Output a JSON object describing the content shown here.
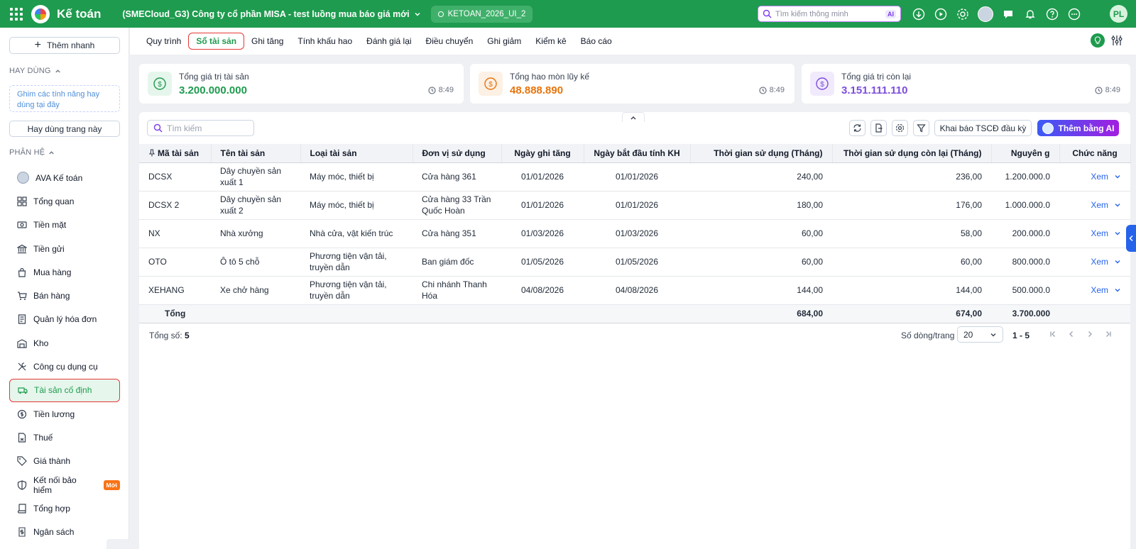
{
  "topbar": {
    "app_name": "Kế toán",
    "company": "(SMECloud_G3) Công ty cổ phần MISA - test luồng mua báo giá mới",
    "database": "KETOAN_2026_UI_2",
    "search_placeholder": "Tìm kiếm thông minh",
    "search_ai_badge": "AI",
    "user_initials": "PL"
  },
  "sidebar": {
    "quick_add": "Thêm nhanh",
    "section_frequent": "HAY DÙNG",
    "pin_hint": "Ghim các tính năng hay dùng tại đây",
    "use_this_page": "Hay dùng trang này",
    "section_modules": "PHÂN HỆ",
    "items": [
      {
        "label": "AVA Kế toán",
        "icon": "ava-avatar-icon"
      },
      {
        "label": "Tổng quan",
        "icon": "dashboard-icon"
      },
      {
        "label": "Tiền mặt",
        "icon": "cash-icon"
      },
      {
        "label": "Tiền gửi",
        "icon": "bank-icon"
      },
      {
        "label": "Mua hàng",
        "icon": "shopping-bag-icon"
      },
      {
        "label": "Bán hàng",
        "icon": "cart-icon"
      },
      {
        "label": "Quản lý hóa đơn",
        "icon": "invoice-icon"
      },
      {
        "label": "Kho",
        "icon": "warehouse-icon"
      },
      {
        "label": "Công cụ dụng cụ",
        "icon": "tools-icon"
      },
      {
        "label": "Tài sản cố định",
        "icon": "truck-icon"
      },
      {
        "label": "Tiền lương",
        "icon": "salary-icon"
      },
      {
        "label": "Thuế",
        "icon": "tax-document-icon"
      },
      {
        "label": "Giá thành",
        "icon": "price-tag-icon"
      },
      {
        "label": "Kết nối bảo hiểm",
        "icon": "shield-icon",
        "badge": "Mới"
      },
      {
        "label": "Tổng hợp",
        "icon": "summary-book-icon"
      },
      {
        "label": "Ngân sách",
        "icon": "budget-icon"
      }
    ]
  },
  "tabs": [
    "Quy trình",
    "Sổ tài sản",
    "Ghi tăng",
    "Tính khấu hao",
    "Đánh giá lại",
    "Điều chuyển",
    "Ghi giảm",
    "Kiểm kê",
    "Báo cáo"
  ],
  "active_tab": "Sổ tài sản",
  "cards": [
    {
      "label": "Tổng giá trị tài sản",
      "value": "3.200.000.000",
      "time": "8:49",
      "color": "#1e9b4e"
    },
    {
      "label": "Tổng hao mòn lũy kế",
      "value": "48.888.890",
      "time": "8:49",
      "color": "#e8740c"
    },
    {
      "label": "Tổng giá trị còn lại",
      "value": "3.151.111.110",
      "time": "8:49",
      "color": "#7c4ddb"
    }
  ],
  "toolbar": {
    "search_placeholder": "Tìm kiếm",
    "declare_button": "Khai báo TSCĐ đầu kỳ",
    "ai_button": "Thêm bằng AI"
  },
  "table": {
    "headers": [
      "Mã tài sản",
      "Tên tài sản",
      "Loại tài sản",
      "Đơn vị sử dụng",
      "Ngày ghi tăng",
      "Ngày bắt đầu tính KH",
      "Thời gian sử dụng (Tháng)",
      "Thời gian sử dụng còn lại (Tháng)",
      "Nguyên g",
      "Chức năng"
    ],
    "rows": [
      {
        "code": "DCSX",
        "name": "Dây chuyền sản xuất 1",
        "type": "Máy móc, thiết bị",
        "unit": "Cửa hàng 361",
        "date_added": "01/01/2026",
        "date_start": "01/01/2026",
        "life": "240,00",
        "remaining": "236,00",
        "cost": "1.200.000.0",
        "action": "Xem"
      },
      {
        "code": "DCSX 2",
        "name": "Dây chuyền sản xuất 2",
        "type": "Máy móc, thiết bị",
        "unit": "Cửa hàng 33 Trần Quốc Hoàn",
        "date_added": "01/01/2026",
        "date_start": "01/01/2026",
        "life": "180,00",
        "remaining": "176,00",
        "cost": "1.000.000.0",
        "action": "Xem"
      },
      {
        "code": "NX",
        "name": "Nhà xưởng",
        "type": "Nhà cửa, vật kiến trúc",
        "unit": "Cửa hàng 351",
        "date_added": "01/03/2026",
        "date_start": "01/03/2026",
        "life": "60,00",
        "remaining": "58,00",
        "cost": "200.000.0",
        "action": "Xem"
      },
      {
        "code": "OTO",
        "name": "Ô tô 5 chỗ",
        "type": "Phương tiện vận tải, truyền dẫn",
        "unit": "Ban giám đốc",
        "date_added": "01/05/2026",
        "date_start": "01/05/2026",
        "life": "60,00",
        "remaining": "60,00",
        "cost": "800.000.0",
        "action": "Xem"
      },
      {
        "code": "XEHANG",
        "name": "Xe chở hàng",
        "type": "Phương tiện vận tải, truyền dẫn",
        "unit": "Chi nhánh Thanh Hóa",
        "date_added": "04/08/2026",
        "date_start": "04/08/2026",
        "life": "144,00",
        "remaining": "144,00",
        "cost": "500.000.0",
        "action": "Xem"
      }
    ],
    "total_label": "Tổng",
    "total_life": "684,00",
    "total_remaining": "674,00",
    "total_cost": "3.700.000"
  },
  "footer": {
    "total_label": "Tổng số:",
    "total_count": "5",
    "rows_per_page_label": "Số dòng/trang",
    "rows_per_page": "20",
    "range": "1 - 5"
  }
}
